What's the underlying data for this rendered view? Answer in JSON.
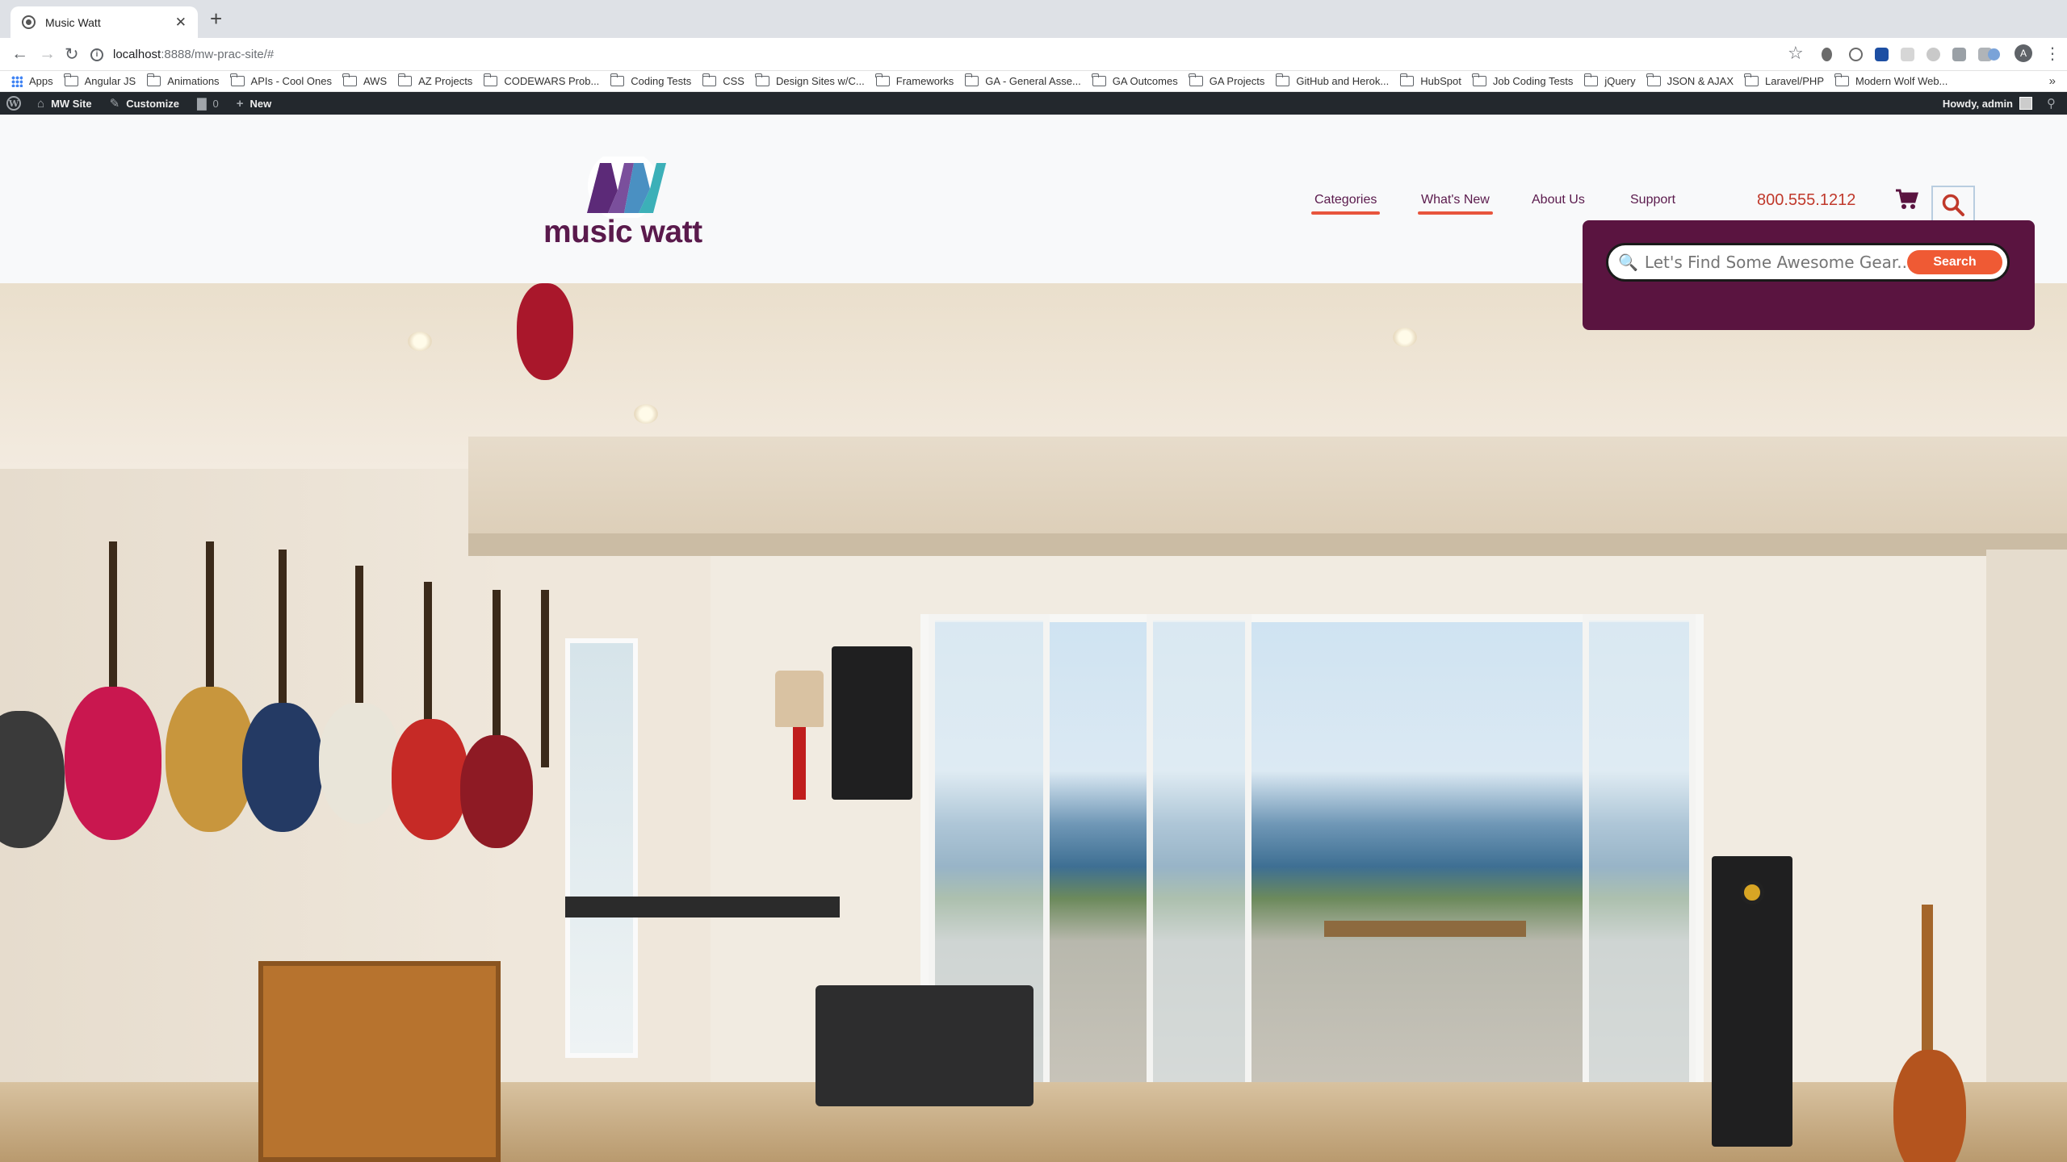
{
  "browser": {
    "tab_title": "Music Watt",
    "url_host": "localhost",
    "url_path": ":8888/mw-prac-site/#",
    "bookmarks": [
      "Apps",
      "Angular JS",
      "Animations",
      "APIs - Cool Ones",
      "AWS",
      "AZ Projects",
      "CODEWARS Prob...",
      "Coding Tests",
      "CSS",
      "Design Sites w/C...",
      "Frameworks",
      "GA - General Asse...",
      "GA Outcomes",
      "GA Projects",
      "GitHub and Herok...",
      "HubSpot",
      "Job Coding Tests",
      "jQuery",
      "JSON & AJAX",
      "Laravel/PHP",
      "Modern Wolf Web..."
    ],
    "bookmarks_overflow": "»",
    "profile_initial": "A"
  },
  "adminbar": {
    "site": "MW Site",
    "customize": "Customize",
    "comments": "0",
    "new": "New",
    "howdy": "Howdy, admin"
  },
  "header": {
    "logo_text": "music watt",
    "nav": {
      "categories": "Categories",
      "whats_new": "What's New",
      "about": "About Us",
      "support": "Support"
    },
    "phone": "800.555.1212"
  },
  "search": {
    "placeholder": "Let's Find Some Awesome Gear...",
    "button": "Search"
  },
  "colors": {
    "brand_plum": "#5a1440",
    "accent_orange": "#ef5a34",
    "phone_red": "#c0392b"
  }
}
